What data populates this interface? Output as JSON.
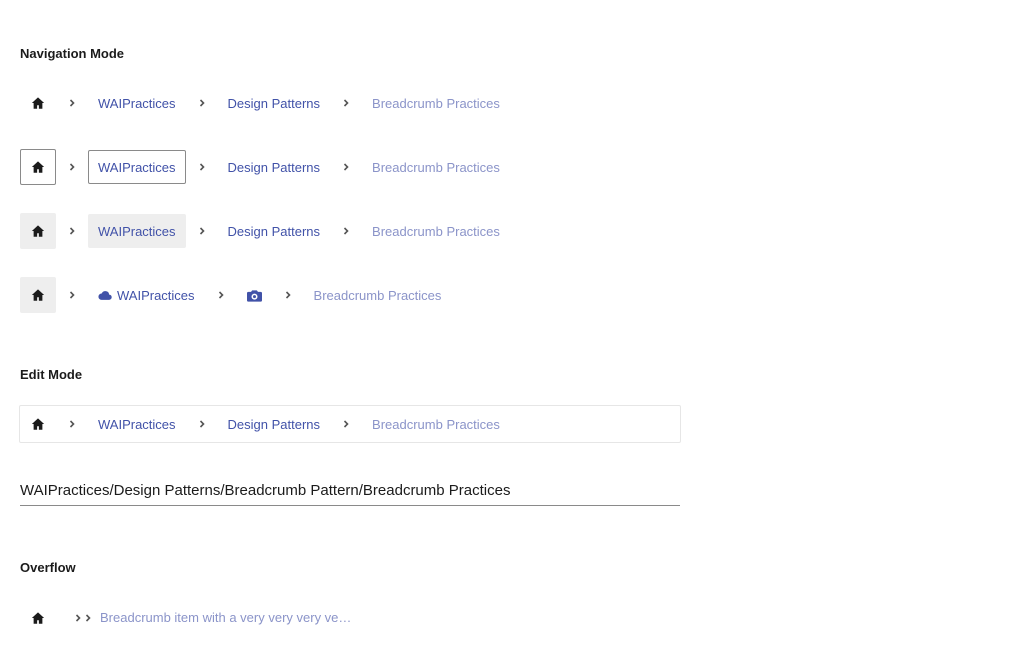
{
  "sections": {
    "navigation": "Navigation Mode",
    "edit": "Edit Mode",
    "overflow": "Overflow"
  },
  "breadcrumb": {
    "item1": "WAIPractices",
    "item2": "Design Patterns",
    "current": "Breadcrumb Practices"
  },
  "icon_row": {
    "item1": "WAIPractices",
    "item1_icon": "cloud-icon",
    "item2_icon": "camera-icon",
    "current": "Breadcrumb Practices"
  },
  "edit_mode": {
    "input_value": "WAIPractices/Design Patterns/Breadcrumb Pattern/Breadcrumb Practices"
  },
  "overflow": {
    "current": "Breadcrumb item with a very very very very long name"
  },
  "colors": {
    "link": "#4152a8",
    "current": "#8b94c9",
    "hover_bg": "#eeeeee",
    "focus_border": "#8a8a8a"
  }
}
